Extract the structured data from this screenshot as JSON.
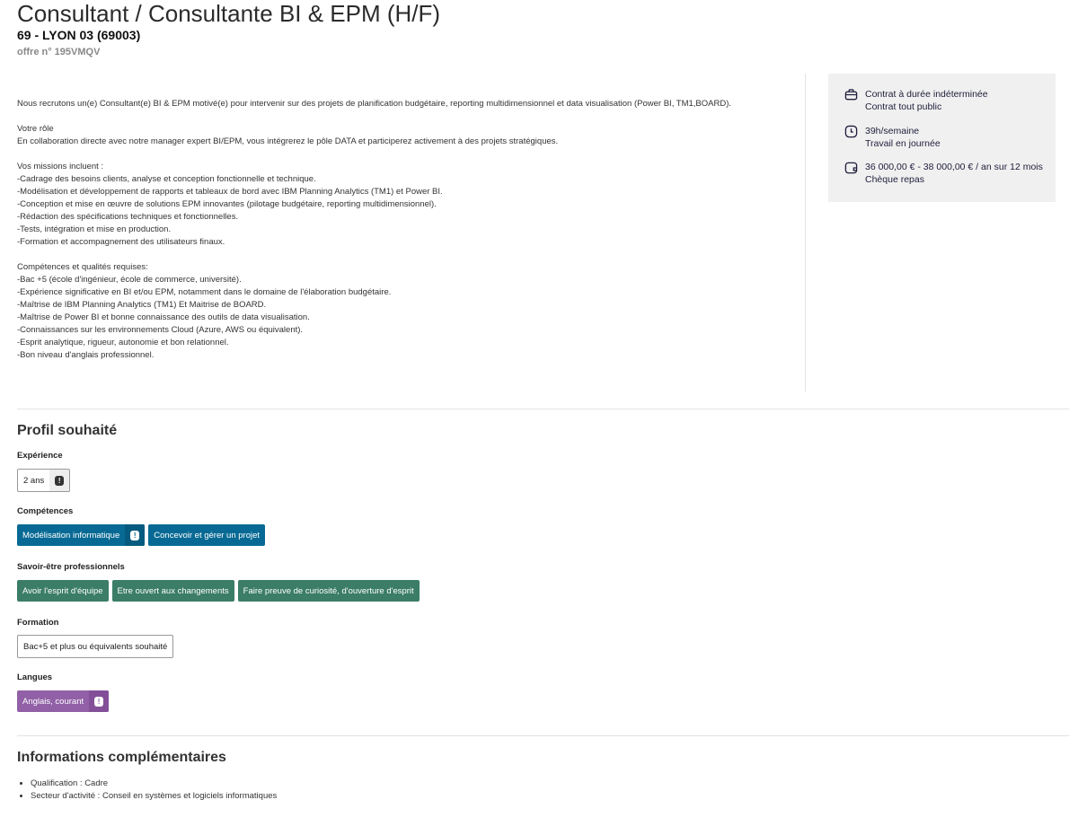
{
  "header": {
    "title": "Consultant / Consultante BI & EPM (H/F)",
    "location": "69 - LYON 03 (69003)",
    "offer_number": "offre n° 195VMQV"
  },
  "description": [
    "Nous recrutons un(e) Consultant(e) BI & EPM motivé(e) pour intervenir sur des projets de planification budgétaire, reporting multidimensionnel et data visualisation (Power BI, TM1,BOARD).",
    "",
    "Votre rôle",
    "En collaboration directe avec notre manager expert BI/EPM, vous intégrerez le pôle DATA et participerez activement à des projets stratégiques.",
    "",
    "Vos missions incluent :",
    "-Cadrage des besoins clients, analyse et conception fonctionnelle et technique.",
    "-Modélisation et développement de rapports et tableaux de bord avec IBM Planning Analytics (TM1) et Power BI.",
    "-Conception et mise en œuvre de solutions EPM innovantes (pilotage budgétaire, reporting multidimensionnel).",
    "-Rédaction des spécifications techniques et fonctionnelles.",
    "-Tests, intégration et mise en production.",
    "-Formation et accompagnement des utilisateurs finaux.",
    "",
    "Compétences et qualités requises:",
    "-Bac +5 (école d'ingénieur, école de commerce, université).",
    "-Expérience significative en BI et/ou EPM, notamment dans le domaine de l'élaboration budgétaire.",
    "-Maîtrise de IBM Planning Analytics (TM1) Et Maitrise de BOARD.",
    "-Maîtrise de Power BI et bonne connaissance des outils de data visualisation.",
    "-Connaissances sur les environnements Cloud (Azure, AWS ou équivalent).",
    "-Esprit analytique, rigueur, autonomie et bon relationnel.",
    "-Bon niveau d'anglais professionnel."
  ],
  "sidebar": {
    "contract": {
      "line1": "Contrat à durée indéterminée",
      "line2": "Contrat tout public"
    },
    "hours": {
      "line1": "39h/semaine",
      "line2": "Travail en journée"
    },
    "salary": {
      "line1": "36 000,00 € - 38 000,00 € / an sur 12 mois",
      "line2": "Chèque repas"
    }
  },
  "profile": {
    "title": "Profil souhaité",
    "experience_label": "Expérience",
    "experience": "2 ans",
    "skills_label": "Compétences",
    "skills": [
      "Modélisation informatique",
      "Concevoir et gérer un projet"
    ],
    "soft_label": "Savoir-être professionnels",
    "soft": [
      "Avoir l'esprit d'équipe",
      "Etre ouvert aux changements",
      "Faire preuve de curiosité, d'ouverture d'esprit"
    ],
    "education_label": "Formation",
    "education": "Bac+5 et plus ou équivalents souhaité",
    "languages_label": "Langues",
    "language": "Anglais, courant"
  },
  "info": {
    "title": "Informations complémentaires",
    "items": [
      "Qualification : Cadre",
      "Secteur d'activité : Conseil en systèmes et logiciels informatiques"
    ]
  },
  "required_mark": "!"
}
